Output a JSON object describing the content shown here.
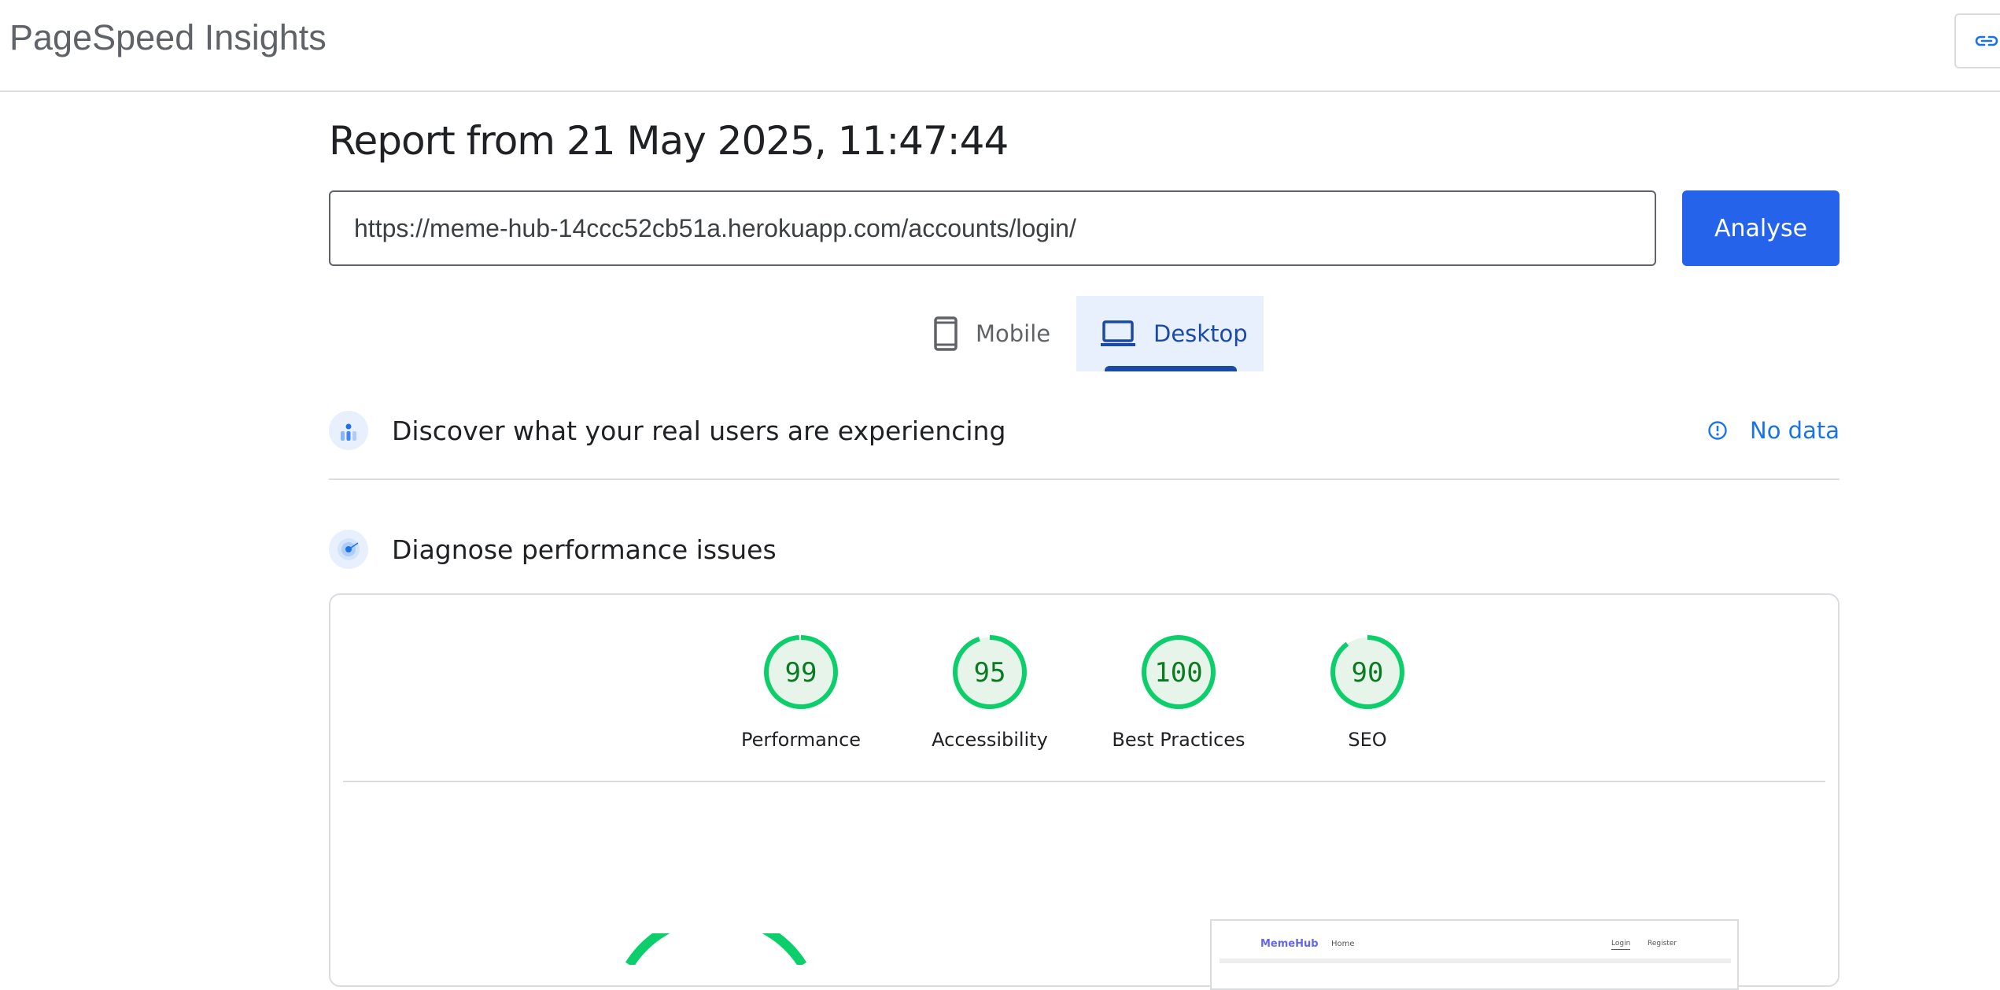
{
  "header": {
    "brand": "PageSpeed Insights",
    "share_icon": "link-icon"
  },
  "report": {
    "title": "Report from 21 May 2025, 11:47:44"
  },
  "search": {
    "url_value": "https://meme-hub-14ccc52cb51a.herokuapp.com/accounts/login/",
    "analyse_label": "Analyse"
  },
  "tabs": [
    {
      "label": "Mobile",
      "icon": "phone-icon",
      "selected": false
    },
    {
      "label": "Desktop",
      "icon": "laptop-icon",
      "selected": true
    }
  ],
  "sections": {
    "field": {
      "title": "Discover what your real users are experiencing",
      "status": "No data",
      "icon": "crux-icon"
    },
    "lab": {
      "title": "Diagnose performance issues",
      "icon": "lighthouse-icon"
    }
  },
  "scores": [
    {
      "label": "Performance",
      "score": "99"
    },
    {
      "label": "Accessibility",
      "score": "95"
    },
    {
      "label": "Best Practices",
      "score": "100"
    },
    {
      "label": "SEO",
      "score": "90"
    }
  ],
  "colors": {
    "accent": "#2563eb",
    "pass": "#0cce6b",
    "pass_bg": "#e6f4ea",
    "tab_bg": "#e8f0fe"
  },
  "thumbnail": {
    "brand": "MemeHub",
    "home": "Home",
    "login": "Login",
    "register": "Register"
  }
}
